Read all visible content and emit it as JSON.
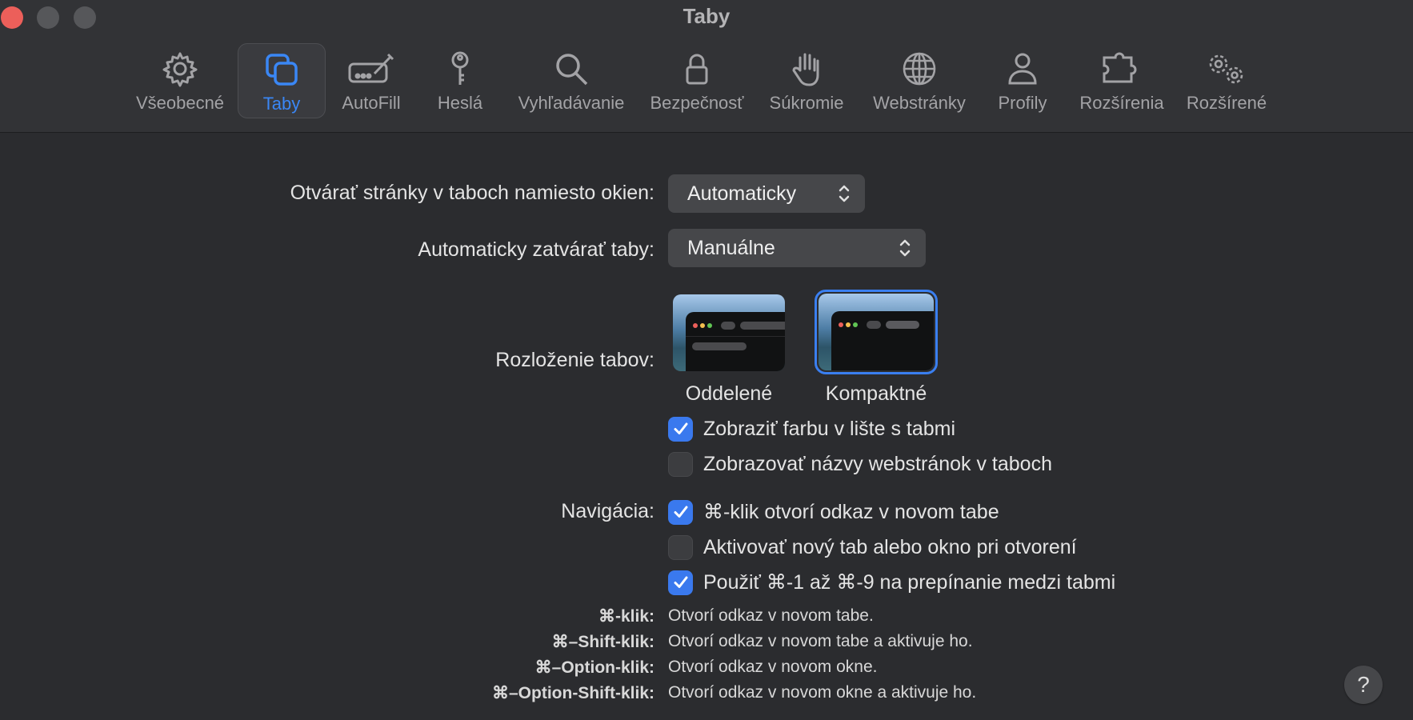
{
  "window": {
    "title": "Taby"
  },
  "toolbar": {
    "items": [
      {
        "label": "Všeobecné",
        "icon": "gear-icon"
      },
      {
        "label": "Taby",
        "icon": "tabs-icon",
        "selected": true
      },
      {
        "label": "AutoFill",
        "icon": "autofill-pencil-icon"
      },
      {
        "label": "Heslá",
        "icon": "key-icon"
      },
      {
        "label": "Vyhľadávanie",
        "icon": "magnifier-icon"
      },
      {
        "label": "Bezpečnosť",
        "icon": "lock-icon"
      },
      {
        "label": "Súkromie",
        "icon": "hand-icon"
      },
      {
        "label": "Webstránky",
        "icon": "globe-icon"
      },
      {
        "label": "Profily",
        "icon": "person-icon"
      },
      {
        "label": "Rozšírenia",
        "icon": "puzzle-icon"
      },
      {
        "label": "Rozšírené",
        "icon": "gears-icon"
      }
    ]
  },
  "settings": {
    "open_pages": {
      "label": "Otvárať stránky v taboch namiesto okien:",
      "value": "Automaticky"
    },
    "auto_close": {
      "label": "Automaticky zatvárať taby:",
      "value": "Manuálne"
    },
    "tab_layout": {
      "label": "Rozloženie tabov:",
      "options": [
        {
          "label": "Oddelené",
          "selected": false
        },
        {
          "label": "Kompaktné",
          "selected": true
        }
      ]
    },
    "show_color": {
      "label": "Zobraziť farbu v lište s tabmi",
      "checked": true
    },
    "show_titles": {
      "label": "Zobrazovať názvy webstránok v taboch",
      "checked": false
    },
    "navigation": {
      "label": "Navigácia:",
      "options": [
        {
          "label": "⌘-klik otvorí odkaz v novom tabe",
          "checked": true
        },
        {
          "label": "Aktivovať nový tab alebo okno pri otvorení",
          "checked": false
        },
        {
          "label": "Použiť ⌘-1 až ⌘-9 na prepínanie medzi tabmi",
          "checked": true
        }
      ]
    },
    "shortcuts": [
      {
        "key": "⌘-klik:",
        "desc": "Otvorí odkaz v novom tabe."
      },
      {
        "key": "⌘–Shift-klik:",
        "desc": "Otvorí odkaz v novom tabe a aktivuje ho."
      },
      {
        "key": "⌘–Option-klik:",
        "desc": "Otvorí odkaz v novom okne."
      },
      {
        "key": "⌘–Option-Shift-klik:",
        "desc": "Otvorí odkaz v novom okne a aktivuje ho."
      }
    ]
  },
  "help": {
    "label": "?"
  },
  "colors": {
    "accent": "#3a79ee",
    "background": "#2b2c2f",
    "close": "#ec5f5a"
  }
}
